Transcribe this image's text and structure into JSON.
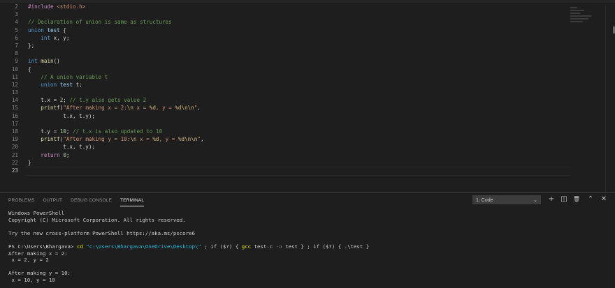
{
  "editor": {
    "lines": [
      {
        "n": "2",
        "tokens": [
          {
            "c": "pp",
            "t": "#include "
          },
          {
            "c": "inc",
            "t": "<stdio.h>"
          }
        ]
      },
      {
        "n": "3",
        "tokens": []
      },
      {
        "n": "4",
        "tokens": [
          {
            "c": "cm",
            "t": "// Declaration of union is same as structures"
          }
        ]
      },
      {
        "n": "5",
        "tokens": [
          {
            "c": "kw",
            "t": "union"
          },
          {
            "c": "plain",
            "t": " "
          },
          {
            "c": "var",
            "t": "test"
          },
          {
            "c": "plain",
            "t": " {"
          }
        ]
      },
      {
        "n": "6",
        "tokens": [
          {
            "c": "plain",
            "t": "    "
          },
          {
            "c": "kw",
            "t": "int"
          },
          {
            "c": "plain",
            "t": " x, y;"
          }
        ]
      },
      {
        "n": "7",
        "tokens": [
          {
            "c": "plain",
            "t": "};"
          }
        ]
      },
      {
        "n": "8",
        "tokens": []
      },
      {
        "n": "9",
        "tokens": [
          {
            "c": "kw",
            "t": "int"
          },
          {
            "c": "plain",
            "t": " "
          },
          {
            "c": "fn",
            "t": "main"
          },
          {
            "c": "plain",
            "t": "()"
          }
        ]
      },
      {
        "n": "10",
        "tokens": [
          {
            "c": "plain",
            "t": "{"
          }
        ]
      },
      {
        "n": "11",
        "tokens": [
          {
            "c": "plain",
            "t": "    "
          },
          {
            "c": "cm",
            "t": "// A union variable t"
          }
        ]
      },
      {
        "n": "12",
        "tokens": [
          {
            "c": "plain",
            "t": "    "
          },
          {
            "c": "kw",
            "t": "union"
          },
          {
            "c": "plain",
            "t": " "
          },
          {
            "c": "var",
            "t": "test"
          },
          {
            "c": "plain",
            "t": " t;"
          }
        ]
      },
      {
        "n": "13",
        "tokens": []
      },
      {
        "n": "14",
        "tokens": [
          {
            "c": "plain",
            "t": "    t.x = "
          },
          {
            "c": "num",
            "t": "2"
          },
          {
            "c": "plain",
            "t": "; "
          },
          {
            "c": "cm",
            "t": "// t.y also gets value 2"
          }
        ]
      },
      {
        "n": "15",
        "tokens": [
          {
            "c": "plain",
            "t": "    "
          },
          {
            "c": "fn",
            "t": "printf"
          },
          {
            "c": "plain",
            "t": "("
          },
          {
            "c": "str",
            "t": "\"After making x = 2:"
          },
          {
            "c": "esc",
            "t": "\\n"
          },
          {
            "c": "str",
            "t": " x = "
          },
          {
            "c": "esc",
            "t": "%d"
          },
          {
            "c": "str",
            "t": ", y = "
          },
          {
            "c": "esc",
            "t": "%d\\n\\n"
          },
          {
            "c": "str",
            "t": "\""
          },
          {
            "c": "plain",
            "t": ","
          }
        ]
      },
      {
        "n": "16",
        "tokens": [
          {
            "c": "plain",
            "t": "           t.x, t.y);"
          }
        ]
      },
      {
        "n": "17",
        "tokens": []
      },
      {
        "n": "18",
        "tokens": [
          {
            "c": "plain",
            "t": "    t.y = "
          },
          {
            "c": "num",
            "t": "10"
          },
          {
            "c": "plain",
            "t": "; "
          },
          {
            "c": "cm",
            "t": "// t.x is also updated to 10"
          }
        ]
      },
      {
        "n": "19",
        "tokens": [
          {
            "c": "plain",
            "t": "    "
          },
          {
            "c": "fn",
            "t": "printf"
          },
          {
            "c": "plain",
            "t": "("
          },
          {
            "c": "str",
            "t": "\"After making y = 10:"
          },
          {
            "c": "esc",
            "t": "\\n"
          },
          {
            "c": "str",
            "t": " x = "
          },
          {
            "c": "esc",
            "t": "%d"
          },
          {
            "c": "str",
            "t": ", y = "
          },
          {
            "c": "esc",
            "t": "%d\\n\\n"
          },
          {
            "c": "str",
            "t": "\""
          },
          {
            "c": "plain",
            "t": ","
          }
        ]
      },
      {
        "n": "20",
        "tokens": [
          {
            "c": "plain",
            "t": "           t.x, t.y);"
          }
        ]
      },
      {
        "n": "21",
        "tokens": [
          {
            "c": "plain",
            "t": "    "
          },
          {
            "c": "pp",
            "t": "return"
          },
          {
            "c": "plain",
            "t": " "
          },
          {
            "c": "num",
            "t": "0"
          },
          {
            "c": "plain",
            "t": ";"
          }
        ]
      },
      {
        "n": "22",
        "tokens": [
          {
            "c": "plain",
            "t": "}"
          }
        ]
      },
      {
        "n": "23",
        "tokens": []
      }
    ]
  },
  "panel": {
    "tabs": [
      {
        "label": "PROBLEMS",
        "active": false
      },
      {
        "label": "OUTPUT",
        "active": false
      },
      {
        "label": "DEBUG CONSOLE",
        "active": false
      },
      {
        "label": "TERMINAL",
        "active": true
      }
    ],
    "terminal_select": "1: Code",
    "icons": {
      "add": "+",
      "split": "◫",
      "trash": "🗑",
      "maximize": "⌃",
      "close": "✕"
    }
  },
  "terminal": {
    "lines": [
      [
        {
          "c": "",
          "t": "Windows PowerShell"
        }
      ],
      [
        {
          "c": "",
          "t": "Copyright (C) Microsoft Corporation. All rights reserved."
        }
      ],
      [
        {
          "c": "",
          "t": ""
        }
      ],
      [
        {
          "c": "",
          "t": "Try the new cross-platform PowerShell https://aka.ms/pscore6"
        }
      ],
      [
        {
          "c": "",
          "t": ""
        }
      ],
      [
        {
          "c": "",
          "t": "PS C:\\Users\\Bhargava> "
        },
        {
          "c": "t-yellow",
          "t": "cd"
        },
        {
          "c": "",
          "t": " "
        },
        {
          "c": "t-cyan",
          "t": "\"c:\\Users\\Bhargava\\OneDrive\\Desktop\\\""
        },
        {
          "c": "",
          "t": " ; if ($?) { "
        },
        {
          "c": "t-yellow",
          "t": "gcc"
        },
        {
          "c": "",
          "t": " test.c "
        },
        {
          "c": "t-gray",
          "t": "-o"
        },
        {
          "c": "",
          "t": " test } ; if ($?) { .\\test }"
        }
      ],
      [
        {
          "c": "",
          "t": "After making x = 2:"
        }
      ],
      [
        {
          "c": "",
          "t": " x = 2, y = 2"
        }
      ],
      [
        {
          "c": "",
          "t": ""
        }
      ],
      [
        {
          "c": "",
          "t": "After making y = 10:"
        }
      ],
      [
        {
          "c": "",
          "t": " x = 10, y = 10"
        }
      ]
    ]
  }
}
